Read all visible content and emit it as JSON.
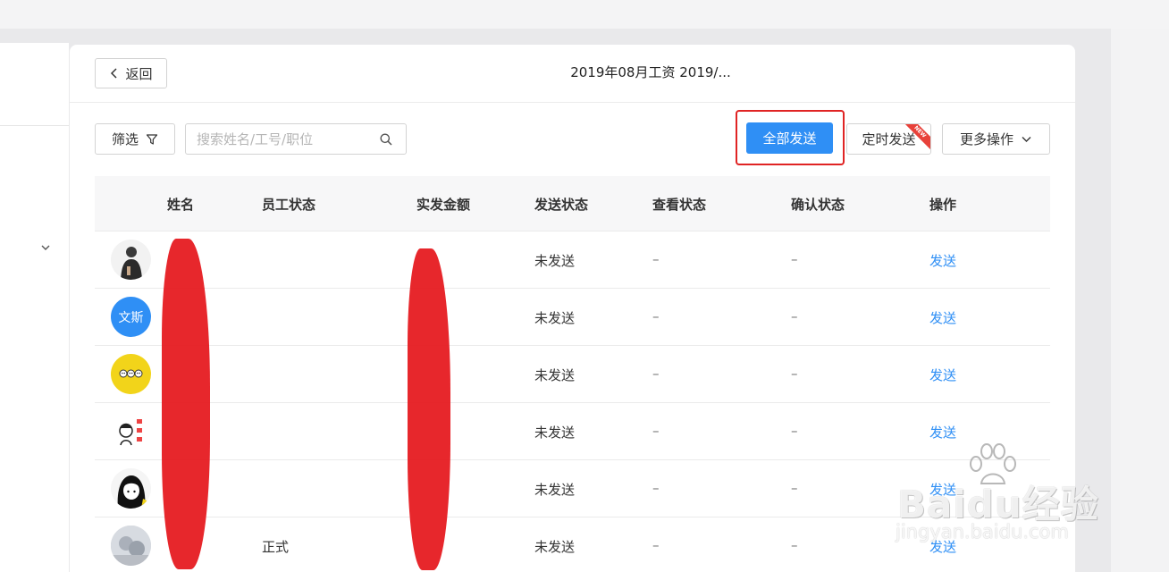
{
  "header": {
    "back_label": "返回",
    "title": "2019年08月工资 2019/..."
  },
  "toolbar": {
    "filter_label": "筛选",
    "search_placeholder": "搜索姓名/工号/职位",
    "send_all_label": "全部发送",
    "timed_send_label": "定时发送",
    "timed_badge": "NEW",
    "more_label": "更多操作"
  },
  "table": {
    "columns": [
      "姓名",
      "员工状态",
      "实发金额",
      "发送状态",
      "查看状态",
      "确认状态",
      "操作"
    ],
    "rows": [
      {
        "avatar": "photo-person",
        "employee_status": "",
        "send_status": "未发送",
        "view_status": "–",
        "confirm_status": "–",
        "action": "发送"
      },
      {
        "avatar": "文斯",
        "employee_status": "",
        "send_status": "未发送",
        "view_status": "–",
        "confirm_status": "–",
        "action": "发送"
      },
      {
        "avatar": "cartoon-yellow",
        "employee_status": "",
        "send_status": "未发送",
        "view_status": "–",
        "confirm_status": "–",
        "action": "发送"
      },
      {
        "avatar": "cartoon-sketch",
        "employee_status": "",
        "send_status": "未发送",
        "view_status": "–",
        "confirm_status": "–",
        "action": "发送"
      },
      {
        "avatar": "cartoon-girl",
        "employee_status": "",
        "send_status": "未发送",
        "view_status": "–",
        "confirm_status": "–",
        "action": "发送"
      },
      {
        "avatar": "photo-gray",
        "employee_status": "正式",
        "send_status": "未发送",
        "view_status": "–",
        "confirm_status": "–",
        "action": "发送"
      }
    ]
  },
  "watermark": {
    "brand": "Baidu经验",
    "url": "jingyan.baidu.com"
  },
  "colors": {
    "primary": "#2f8ff5",
    "highlight": "#e02424",
    "redaction": "#e5151a"
  }
}
